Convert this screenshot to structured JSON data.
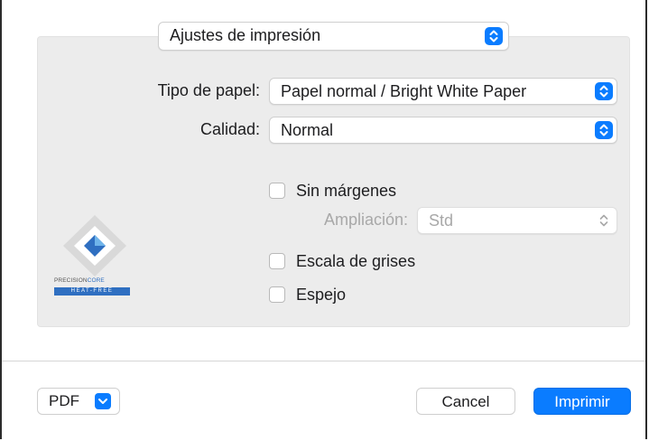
{
  "preset_popup": {
    "value": "Ajustes de impresión"
  },
  "paper_type": {
    "label": "Tipo de papel:",
    "value": "Papel normal / Bright White Paper"
  },
  "quality": {
    "label": "Calidad:",
    "value": "Normal"
  },
  "borderless": {
    "label": "Sin márgenes",
    "checked": false
  },
  "expansion": {
    "label": "Ampliación:",
    "value": "Std",
    "enabled": false
  },
  "grayscale": {
    "label": "Escala de grises",
    "checked": false
  },
  "mirror": {
    "label": "Espejo",
    "checked": false
  },
  "logo": {
    "line1_a": "PRECISION",
    "line1_b": "CORE",
    "line2": "HEAT-FREE"
  },
  "footer": {
    "pdf_label": "PDF",
    "cancel_label": "Cancel",
    "print_label": "Imprimir"
  },
  "colors": {
    "accent": "#0a7cff",
    "panel": "#ececec",
    "disabled_text": "#a8a8a8"
  },
  "icons": {
    "popup_arrow": "up-down-chevron-icon",
    "pdf_menu": "chevron-down-icon"
  }
}
